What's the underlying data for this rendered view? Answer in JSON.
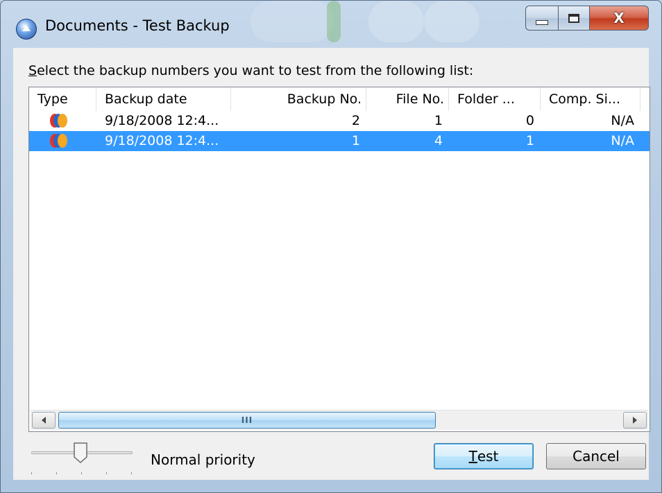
{
  "window": {
    "title": "Documents - Test Backup",
    "close_glyph": "X",
    "app_icon": "upload-disc-icon"
  },
  "prompt": {
    "accel": "S",
    "rest": "elect the backup numbers you want to test from the following list:"
  },
  "list": {
    "columns": [
      "Type",
      "Backup date",
      "Backup No.",
      "File No.",
      "Folder ...",
      "Comp. Si..."
    ],
    "rows": [
      {
        "type_icon": "backup-type-icon",
        "date": "9/18/2008 12:4...",
        "backup_no": "2",
        "file_no": "1",
        "folder": "0",
        "comp": "N/A",
        "selected": false
      },
      {
        "type_icon": "backup-type-icon",
        "date": "9/18/2008 12:4...",
        "backup_no": "1",
        "file_no": "4",
        "folder": "1",
        "comp": "N/A",
        "selected": true
      }
    ],
    "scroll_grip": "III"
  },
  "priority": {
    "label": "Normal priority",
    "level": 0.5
  },
  "buttons": {
    "test_accel": "T",
    "test_rest": "est",
    "cancel": "Cancel"
  },
  "colors": {
    "selection": "#3399ff",
    "default_button_border": "#3c7fb1"
  }
}
